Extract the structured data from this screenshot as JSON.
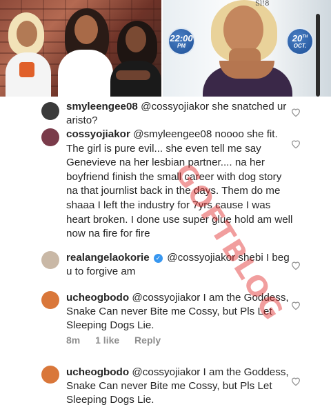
{
  "photos": {
    "left_alt": "three women posing",
    "right_alt": "woman on camera",
    "badge_time": {
      "big": "22:00",
      "small": "PM"
    },
    "badge_date": {
      "big": "20",
      "sup": "TH",
      "small": "OCT."
    },
    "top_text": "Sl!8"
  },
  "comments": [
    {
      "username": "smyleengee08",
      "text": "@cossyojiakor she snatched ur aristo?",
      "avatar_color": "#3a3a3a"
    },
    {
      "username": "cossyojiakor",
      "text": "@smyleengee08 noooo she fit. The girl is pure evil... she even tell me say Genevieve na her lesbian partner.... na her boyfriend finish the small career with dog story na that journlist back in the days. Them do me shaaa I left the industry for 7yrs cause I was heart broken. I done use super glue hold am well now na fire for fire",
      "avatar_color": "#7a3b4a"
    },
    {
      "username": "realangelaokorie",
      "verified_mark": "✓",
      "text": "@cossyojiakor shebi I beg u to forgive am",
      "avatar_color": "#c9b8a6"
    },
    {
      "username": "ucheogbodo",
      "text": "@cossyojiakor I am the Goddess, Snake Can never Bite me Cossy, but Pls Let Sleeping Dogs Lie.",
      "avatar_color": "#d9773a",
      "meta": {
        "time": "8m",
        "likes": "1 like",
        "reply": "Reply"
      }
    },
    {
      "username": "ucheogbodo",
      "text": "@cossyojiakor I am the Goddess, Snake Can never Bite me Cossy, but Pls Let Sleeping Dogs Lie.",
      "avatar_color": "#d9773a"
    }
  ],
  "watermark": "GOFTBLOG",
  "icons": {
    "like": "heart-outline-icon",
    "verified": "verified-badge-icon"
  }
}
